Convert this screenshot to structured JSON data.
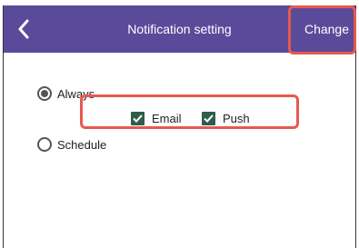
{
  "header": {
    "title": "Notification setting",
    "change_label": "Change",
    "background_color": "#5a4a9a"
  },
  "options": {
    "always_label": "Always",
    "always_selected": true,
    "schedule_label": "Schedule",
    "schedule_selected": false
  },
  "channels": {
    "email_label": "Email",
    "email_checked": true,
    "push_label": "Push",
    "push_checked": true,
    "check_color": "#2f5d4a"
  },
  "annotation": {
    "highlight_color": "#e8584f"
  },
  "icons": {
    "back": "chevron-left-icon",
    "check": "checkmark-icon"
  }
}
